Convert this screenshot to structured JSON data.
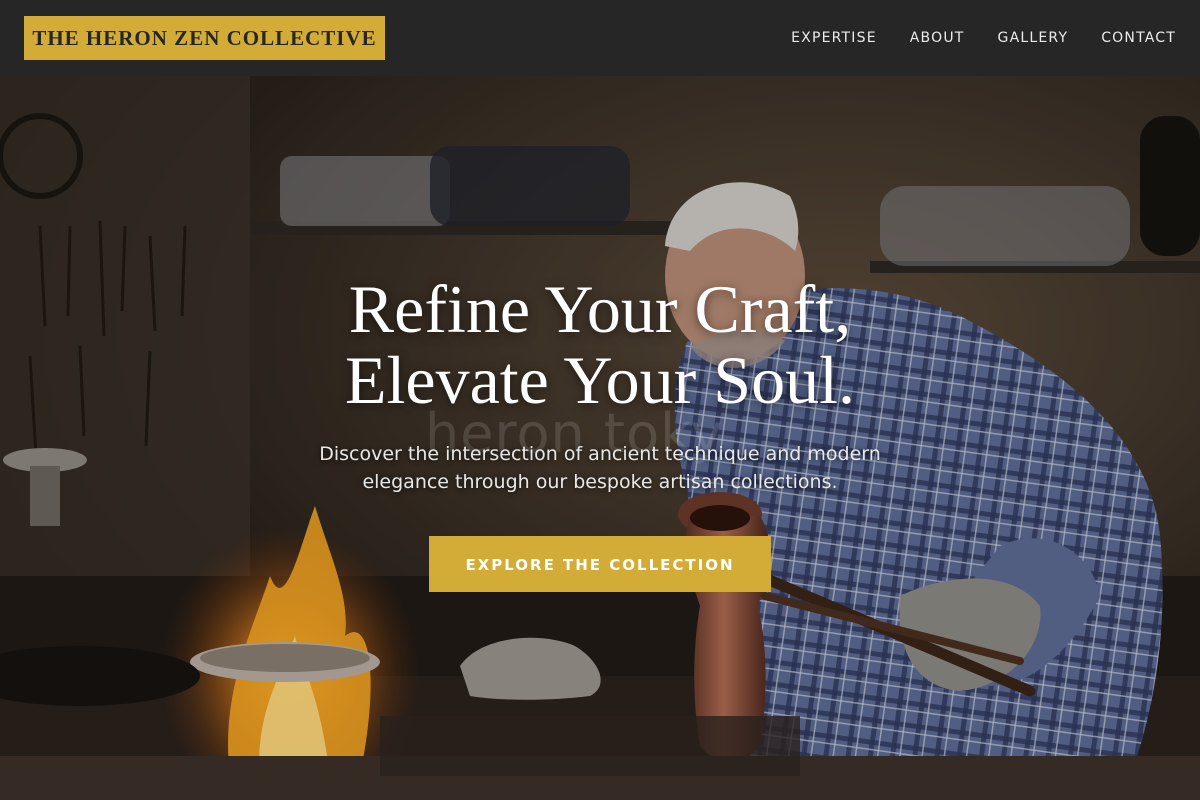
{
  "brand": {
    "name": "THE HERON ZEN COLLECTIVE",
    "accent": "#d2ac36",
    "header_bg": "#262626"
  },
  "nav": {
    "items": [
      {
        "label": "EXPERTISE"
      },
      {
        "label": "ABOUT"
      },
      {
        "label": "GALLERY"
      },
      {
        "label": "CONTACT"
      }
    ]
  },
  "hero": {
    "title_line1": "Refine Your Craft,",
    "title_line2": "Elevate Your Soul.",
    "subtitle_line1": "Discover the intersection of ancient technique and modern",
    "subtitle_line2": "elegance through our bespoke artisan collections.",
    "cta_label": "EXPLORE THE COLLECTION",
    "watermark": "heron toky",
    "image": "craftsman-coppersmith-workshop-photo"
  }
}
